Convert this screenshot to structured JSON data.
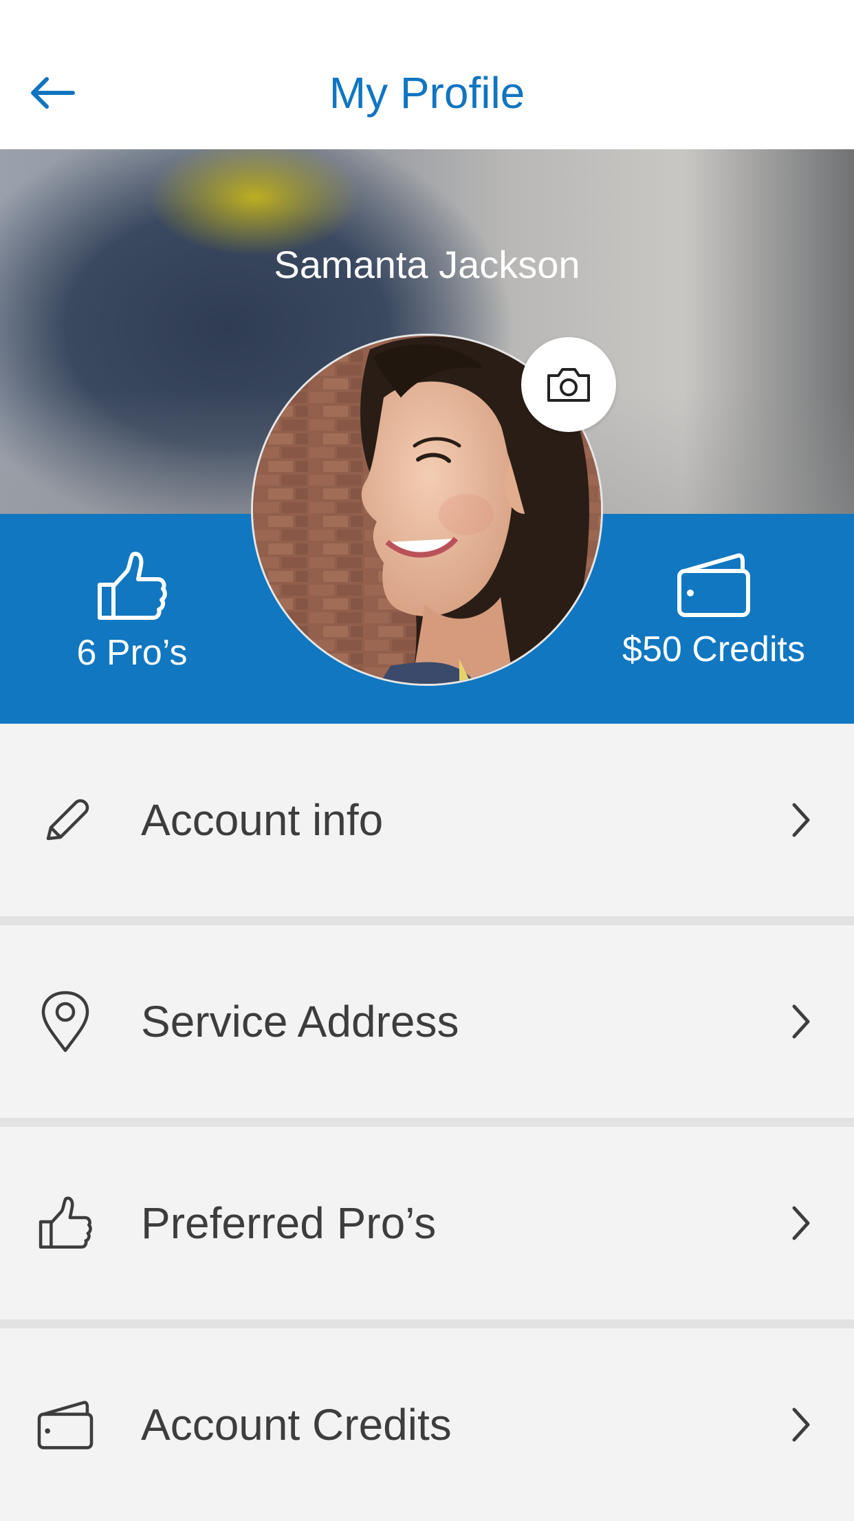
{
  "header": {
    "title": "My Profile",
    "back_icon": "arrow-left-icon"
  },
  "profile": {
    "name": "Samanta Jackson",
    "camera_icon": "camera-icon"
  },
  "stats": {
    "pros": {
      "label": "6 Pro’s",
      "icon": "thumbs-up-icon"
    },
    "credits": {
      "label": "$50 Credits",
      "icon": "wallet-icon"
    }
  },
  "menu": {
    "items": [
      {
        "label": "Account info",
        "icon": "pencil-icon"
      },
      {
        "label": "Service Address",
        "icon": "location-pin-icon"
      },
      {
        "label": "Preferred Pro’s",
        "icon": "thumbs-up-icon"
      },
      {
        "label": "Account Credits",
        "icon": "wallet-icon"
      }
    ]
  },
  "colors": {
    "accent": "#1175c0",
    "stats_bar": "#1177c0",
    "menu_background": "#f3f3f3",
    "menu_text": "#3d3d3d"
  }
}
